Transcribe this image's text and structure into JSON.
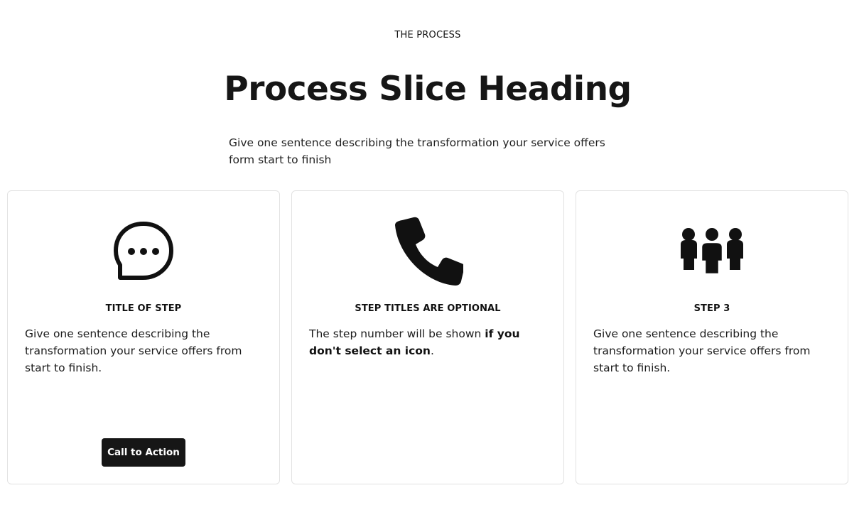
{
  "header": {
    "eyebrow": "THE PROCESS",
    "title": "Process Slice Heading",
    "subtitle": "Give one sentence describing the transformation your service offers form start to finish"
  },
  "steps": [
    {
      "icon": "chat-bubble-icon",
      "title": "TITLE OF STEP",
      "body": "Give one sentence describing the transformation your service offers from start to finish.",
      "cta_label": "Call to Action"
    },
    {
      "icon": "phone-icon",
      "title": "STEP TITLES ARE OPTIONAL",
      "body_prefix": "The step number will be shown ",
      "body_bold": "if you don't select an icon",
      "body_suffix": "."
    },
    {
      "icon": "group-icon",
      "title": "STEP 3",
      "body": "Give one sentence describing the transformation your service offers from start to finish."
    }
  ],
  "colors": {
    "text": "#111111",
    "button_bg": "#161616",
    "card_border": "#e2e2e2"
  }
}
